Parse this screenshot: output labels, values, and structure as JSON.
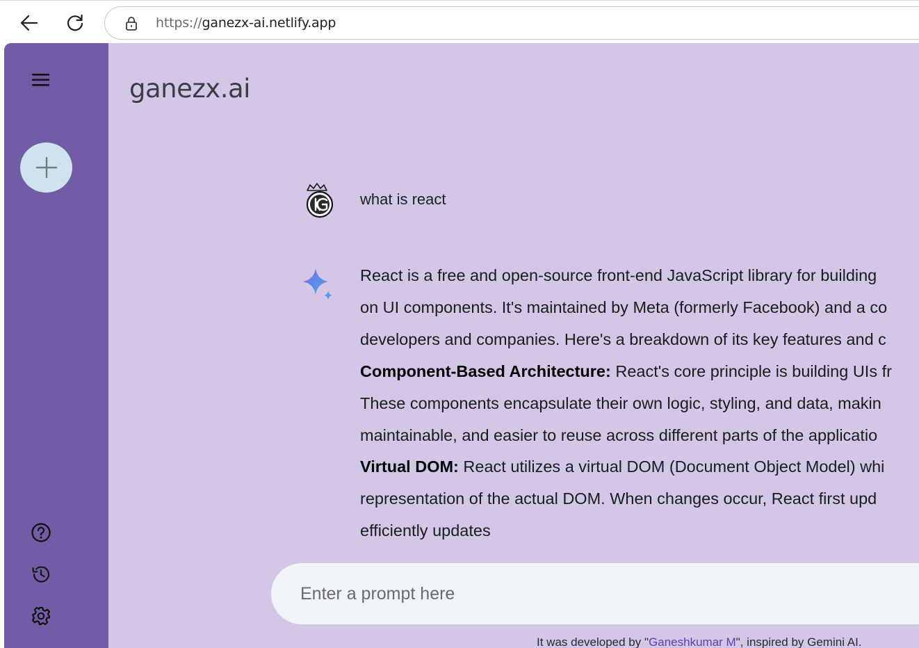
{
  "browser": {
    "url_scheme": "https://",
    "url_host": "ganezx-ai.netlify.app"
  },
  "app": {
    "brand": "ganezx.ai",
    "sidebar": {
      "menu_icon": "hamburger-menu-icon",
      "new_chat_icon": "plus-icon",
      "help_icon": "help-circle-icon",
      "history_icon": "history-icon",
      "settings_icon": "gear-icon"
    },
    "conversation": {
      "user_message": "what is react",
      "response_lines": [
        {
          "bold": "",
          "text": "React is a free and open-source front-end JavaScript library for building"
        },
        {
          "bold": "",
          "text": "on UI components. It's maintained by Meta (formerly Facebook) and a co"
        },
        {
          "bold": "",
          "text": "developers and companies. Here's a breakdown of its key features and c"
        },
        {
          "bold": "Component-Based Architecture:",
          "text": " React's core principle is building UIs fr"
        },
        {
          "bold": "",
          "text": "These components encapsulate their own logic, styling, and data, makin"
        },
        {
          "bold": "",
          "text": "maintainable, and easier to reuse across different parts of the applicatio"
        },
        {
          "bold": "Virtual DOM:",
          "text": " React utilizes a virtual DOM (Document Object Model) whi"
        },
        {
          "bold": "",
          "text": "representation of the actual DOM. When changes occur, React first upd"
        },
        {
          "bold": "",
          "text": "efficiently updates"
        }
      ]
    },
    "prompt": {
      "placeholder": "Enter a prompt here"
    },
    "footer": {
      "prefix": "It was developed by \"",
      "author": "Ganeshkumar M",
      "suffix": "\", inspired by Gemini AI."
    },
    "colors": {
      "sidebar": "#725ca6",
      "main_bg": "#d4c6e6",
      "new_chat_bg": "#cfe3ec",
      "prompt_bg": "#f0f3f8",
      "link": "#5a3fb0"
    }
  }
}
